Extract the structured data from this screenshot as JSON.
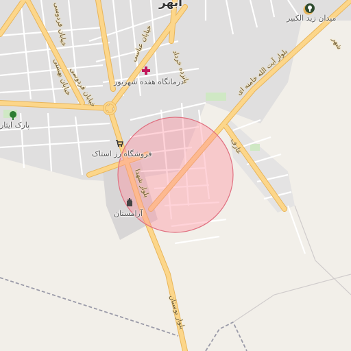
{
  "map": {
    "city_label": "ابهر",
    "labels": {
      "clinic": "درمانگاه هفده شهریور",
      "park": "پارک ایثار",
      "store": "فروشگاه رز استاک",
      "cemetery": "آرامستان",
      "square": "میدان زید الکبیر"
    },
    "streets": {
      "abbasi": "خیابان عباسی",
      "ferdowsi": "خیابان فردوسی",
      "beheshti": "خیابان بهشتی",
      "ferdowsi2": "خیابان فردوسی",
      "khordad": "پانزده خرداد",
      "khamenei": "بلوار آیت الله خامنه ای",
      "aref": "عارف",
      "shohada": "بلوار شهدا",
      "bustan": "بلوار بوستان",
      "shahr": "شهر"
    },
    "icons": [
      "hospital-icon",
      "tree-icon",
      "shopping-cart-icon",
      "cemetery-icon",
      "monument-icon"
    ],
    "colors": {
      "background": "#f2efe9",
      "major_road": "#fcd68a",
      "major_road_casing": "#e8b55a",
      "minor_road": "#ffffff",
      "circle_fill": "#ff8c9a",
      "circle_stroke": "#e07080",
      "boundary": "#9a9aa8"
    }
  }
}
